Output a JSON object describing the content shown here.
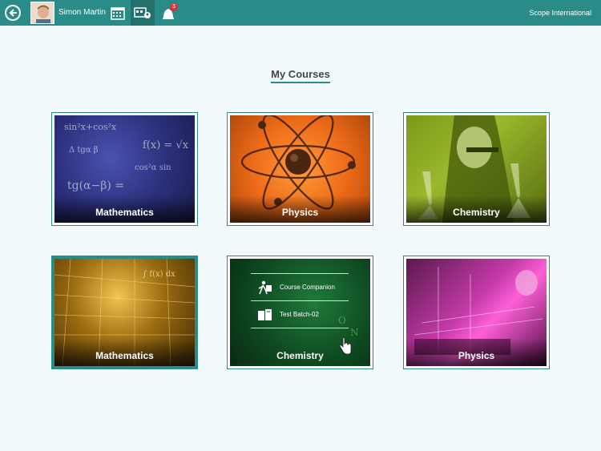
{
  "header": {
    "user_name": "Simon Martin",
    "notification_count": "3",
    "organization": "Scope International",
    "accent_color": "#2a8c88",
    "icons": [
      "back-arrow-icon",
      "calendar-icon",
      "courses-icon",
      "notifications-icon"
    ]
  },
  "page": {
    "title": "My Courses"
  },
  "courses": [
    {
      "label": "Mathematics"
    },
    {
      "label": "Physics"
    },
    {
      "label": "Chemistry"
    },
    {
      "label": "Mathematics"
    },
    {
      "label": "Chemistry",
      "menu": [
        {
          "label": "Course Companion"
        },
        {
          "label": "Test Batch-02"
        }
      ]
    },
    {
      "label": "Physics"
    }
  ]
}
